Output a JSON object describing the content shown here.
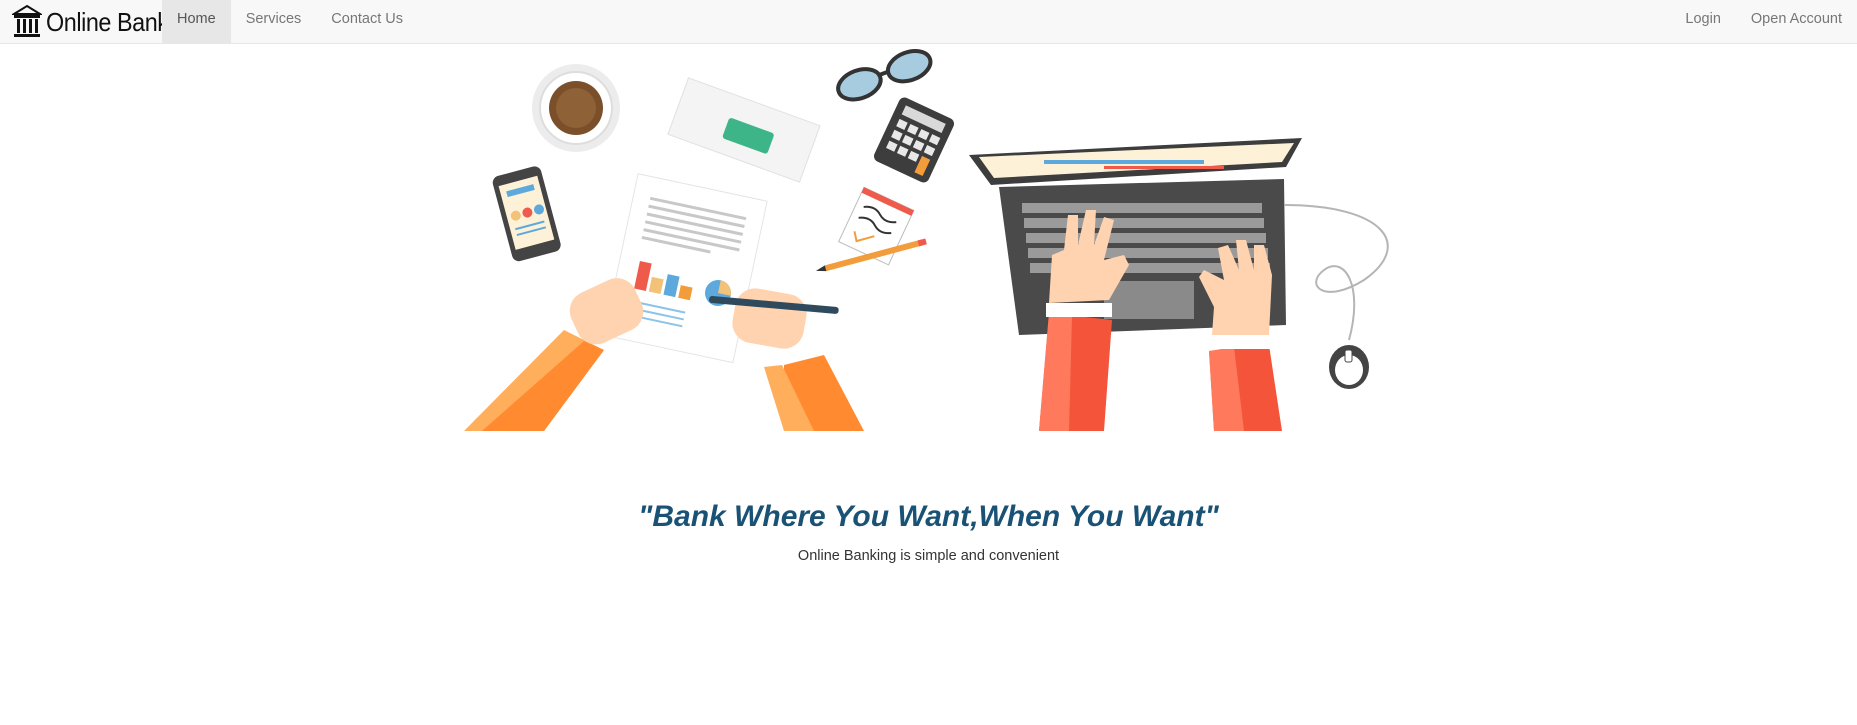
{
  "brand": {
    "name": "Online Bank",
    "icon": "bank-building-icon"
  },
  "nav": {
    "left": [
      {
        "label": "Home",
        "active": true
      },
      {
        "label": "Services",
        "active": false
      },
      {
        "label": "Contact Us",
        "active": false
      }
    ],
    "right": [
      {
        "label": "Login"
      },
      {
        "label": "Open Account"
      }
    ]
  },
  "hero": {
    "illustration": "workdesk-laptop-illustration",
    "tagline": "\"Bank Where You Want,When You Want\"",
    "subtext": "Online Banking is simple and convenient"
  },
  "colors": {
    "navbar_bg": "#f8f8f8",
    "active_tab_bg": "#e7e7e7",
    "tagline": "#1a5276",
    "accent_orange": "#ff8a2f",
    "accent_red": "#f4553a"
  }
}
